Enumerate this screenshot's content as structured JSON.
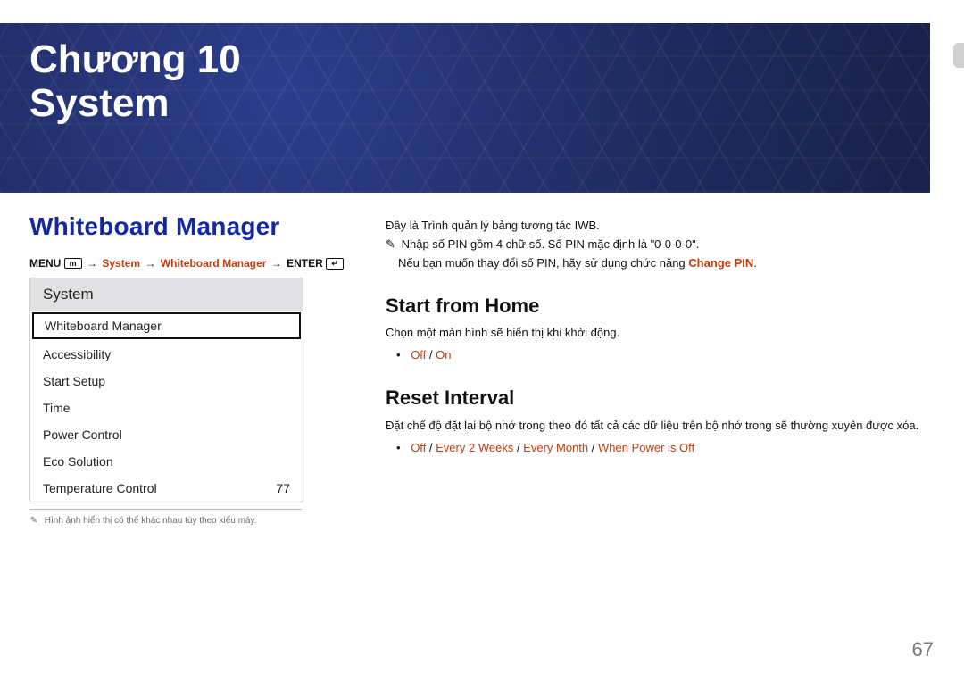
{
  "hero": {
    "chapter_line": "Chương 10",
    "title": "System"
  },
  "section_title": "Whiteboard Manager",
  "breadcrumb": {
    "menu_label": "MENU",
    "menu_icon": "m",
    "path1": "System",
    "path2": "Whiteboard Manager",
    "enter_label": "ENTER",
    "enter_icon": "↵",
    "arrow": "→"
  },
  "panel": {
    "header": "System",
    "items": [
      {
        "label": "Whiteboard Manager",
        "highlight": true
      },
      {
        "label": "Accessibility"
      },
      {
        "label": "Start Setup"
      },
      {
        "label": "Time"
      },
      {
        "label": "Power Control"
      },
      {
        "label": "Eco Solution"
      },
      {
        "label": "Temperature Control",
        "value": "77"
      }
    ],
    "footnote": "Hình ảnh hiển thị có thể khác nhau tùy theo kiểu máy."
  },
  "right": {
    "intro": "Đây là Trình quản lý bảng tương tác IWB.",
    "pin_note_1": "Nhập số PIN gồm 4 chữ số. Số PIN mặc định là \"0-0-0-0\".",
    "pin_note_2_prefix": "Nếu bạn muốn thay đổi số PIN, hãy sử dụng chức năng ",
    "pin_note_2_accent": "Change PIN",
    "pin_note_2_suffix": ".",
    "h_start": "Start from Home",
    "start_desc": "Chọn một màn hình sẽ hiển thị khi khởi động.",
    "start_opt_off": "Off",
    "start_opt_on": "On",
    "h_reset": "Reset Interval",
    "reset_desc": "Đặt chế độ đặt lại bộ nhớ trong theo đó tất cả các dữ liệu trên bộ nhớ trong sẽ thường xuyên được xóa.",
    "reset_opt_off": "Off",
    "reset_opt_1": "Every 2 Weeks",
    "reset_opt_2": "Every Month",
    "reset_opt_3": "When Power is Off",
    "sep": " / "
  },
  "page_number": "67",
  "glyphs": {
    "pencil": "✎"
  }
}
